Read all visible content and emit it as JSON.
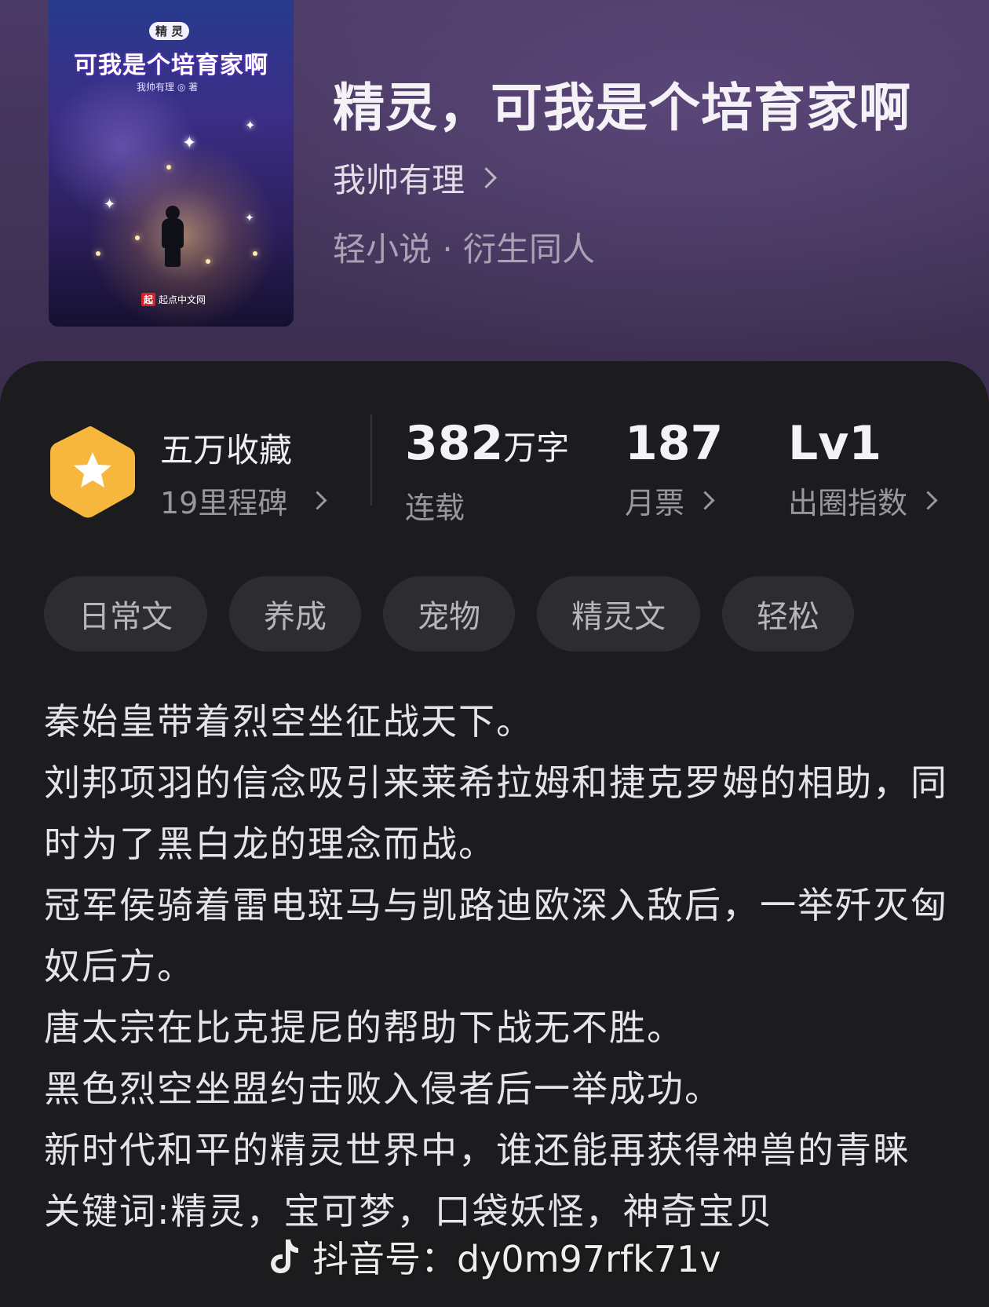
{
  "book": {
    "title": "精灵，可我是个培育家啊",
    "author": "我帅有理",
    "genre": "轻小说 · 衍生同人"
  },
  "cover": {
    "badge": "精 灵",
    "title": "可我是个培育家啊",
    "author": "我帅有理 ◎ 著",
    "publisher": "起点中文网",
    "publisher_mark": "起"
  },
  "stats": {
    "milestone": {
      "main": "五万收藏",
      "sub": "19里程碑"
    },
    "words": {
      "value": "382",
      "unit": "万字",
      "label": "连载"
    },
    "monthly_ticket": {
      "value": "187",
      "label": "月票"
    },
    "index": {
      "value": "Lv1",
      "label": "出圈指数"
    }
  },
  "tags": [
    "日常文",
    "养成",
    "宠物",
    "精灵文",
    "轻松"
  ],
  "description": [
    "秦始皇带着烈空坐征战天下。",
    "刘邦项羽的信念吸引来莱希拉姆和捷克罗姆的相助，同时为了黑白龙的理念而战。",
    "冠军侯骑着雷电斑马与凯路迪欧深入敌后，一举歼灭匈奴后方。",
    "唐太宗在比克提尼的帮助下战无不胜。",
    "黑色烈空坐盟约击败入侵者后一举成功。",
    "新时代和平的精灵世界中，谁还能再获得神兽的青睐",
    "关键词:精灵，宝可梦，口袋妖怪，神奇宝贝"
  ],
  "watermark": {
    "text": "抖音号：dy0m97rfk71v",
    "icon": "tiktok-icon"
  },
  "colors": {
    "badge": "#f6b73c",
    "panel": "#1c1b1d",
    "hero": "#43345a"
  }
}
